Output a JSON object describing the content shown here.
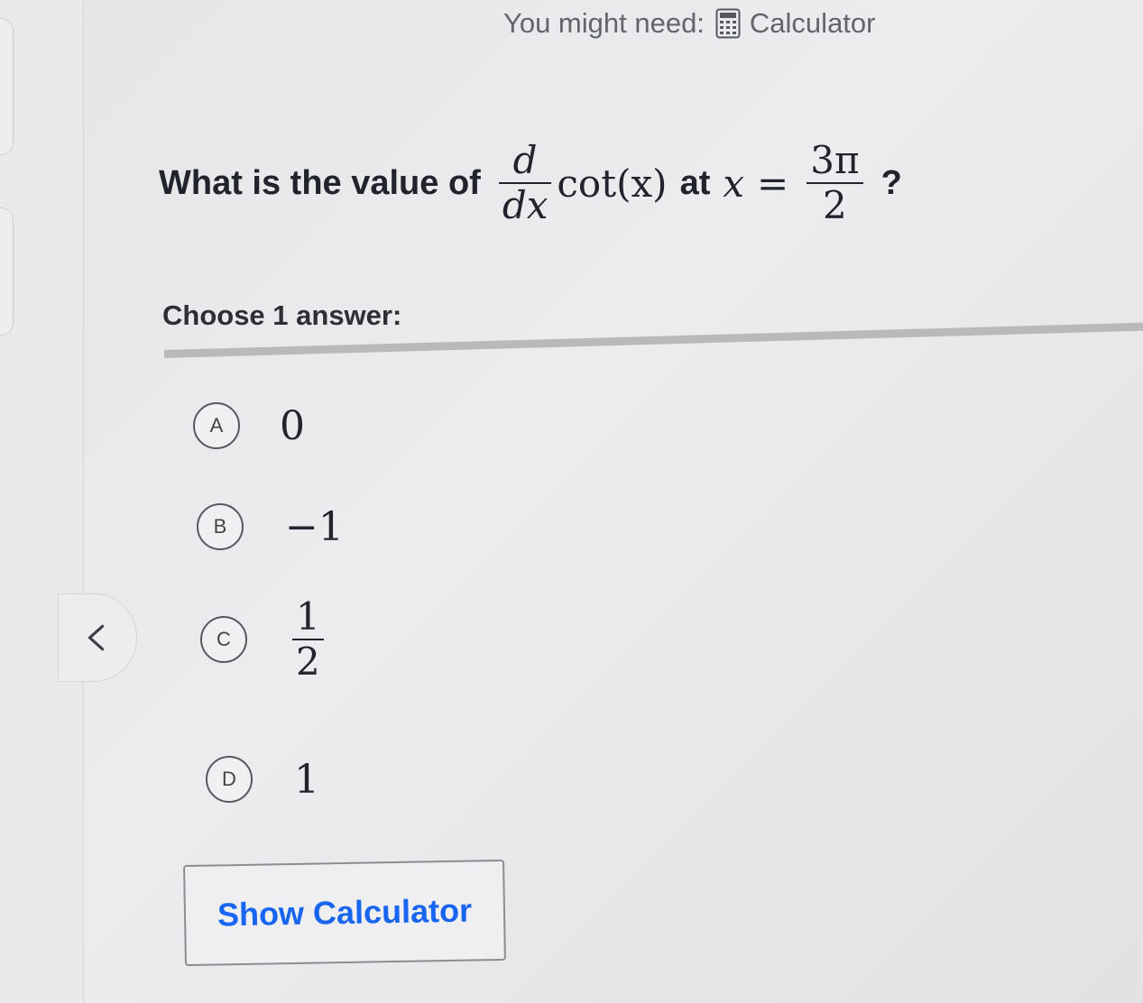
{
  "header": {
    "might_need_label": "You might need:",
    "tool_label": "Calculator",
    "tool_icon": "calculator-icon"
  },
  "question": {
    "prefix": "What is the value of",
    "deriv_num": "d",
    "deriv_den": "dx",
    "func": "cot(x)",
    "at_text": "at",
    "var": "x",
    "equals": "=",
    "value_num": "3π",
    "value_den": "2",
    "end": "?"
  },
  "choose_label": "Choose 1 answer:",
  "choices": [
    {
      "letter": "A",
      "value": "0"
    },
    {
      "letter": "B",
      "value": "−1"
    },
    {
      "letter": "C",
      "num": "1",
      "den": "2"
    },
    {
      "letter": "D",
      "value": "1"
    }
  ],
  "show_calculator_label": "Show Calculator",
  "colors": {
    "accent": "#1865f2",
    "text": "#21242c",
    "muted": "#626569"
  }
}
